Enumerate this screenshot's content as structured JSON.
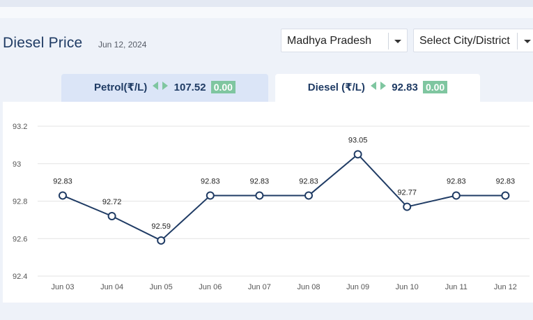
{
  "header": {
    "title": "Diesel Price",
    "date": "Jun 12, 2024",
    "state_select": {
      "value": "Madhya Pradesh"
    },
    "city_select": {
      "value": "Select City/District"
    }
  },
  "tabs": [
    {
      "label": "Petrol(₹/L)",
      "price": "107.52",
      "change": "0.00",
      "active": false
    },
    {
      "label": "Diesel (₹/L)",
      "price": "92.83",
      "change": "0.00",
      "active": true
    }
  ],
  "colors": {
    "title": "#1f3b64",
    "line": "#1f3b64",
    "badge": "#7fc6a0",
    "active_tab": "#ffffff",
    "inactive_tab": "#dbe5f7"
  },
  "chart_data": {
    "type": "line",
    "title": "",
    "xlabel": "",
    "ylabel": "",
    "categories": [
      "Jun 03",
      "Jun 04",
      "Jun 05",
      "Jun 06",
      "Jun 07",
      "Jun 08",
      "Jun 09",
      "Jun 10",
      "Jun 11",
      "Jun 12"
    ],
    "series": [
      {
        "values": [
          92.83,
          92.72,
          92.59,
          92.83,
          92.83,
          92.83,
          93.05,
          92.77,
          92.83,
          92.83
        ]
      }
    ],
    "data_labels": [
      "92.83",
      "92.72",
      "92.59",
      "92.83",
      "92.83",
      "92.83",
      "93.05",
      "92.77",
      "92.83",
      "92.83"
    ],
    "ylim": [
      92.4,
      93.2
    ],
    "yticks": [
      92.4,
      92.6,
      92.8,
      93,
      93.2
    ],
    "ytick_labels": [
      "92.4",
      "92.6",
      "92.8",
      "93",
      "93.2"
    ],
    "grid": true,
    "legend": "none"
  }
}
